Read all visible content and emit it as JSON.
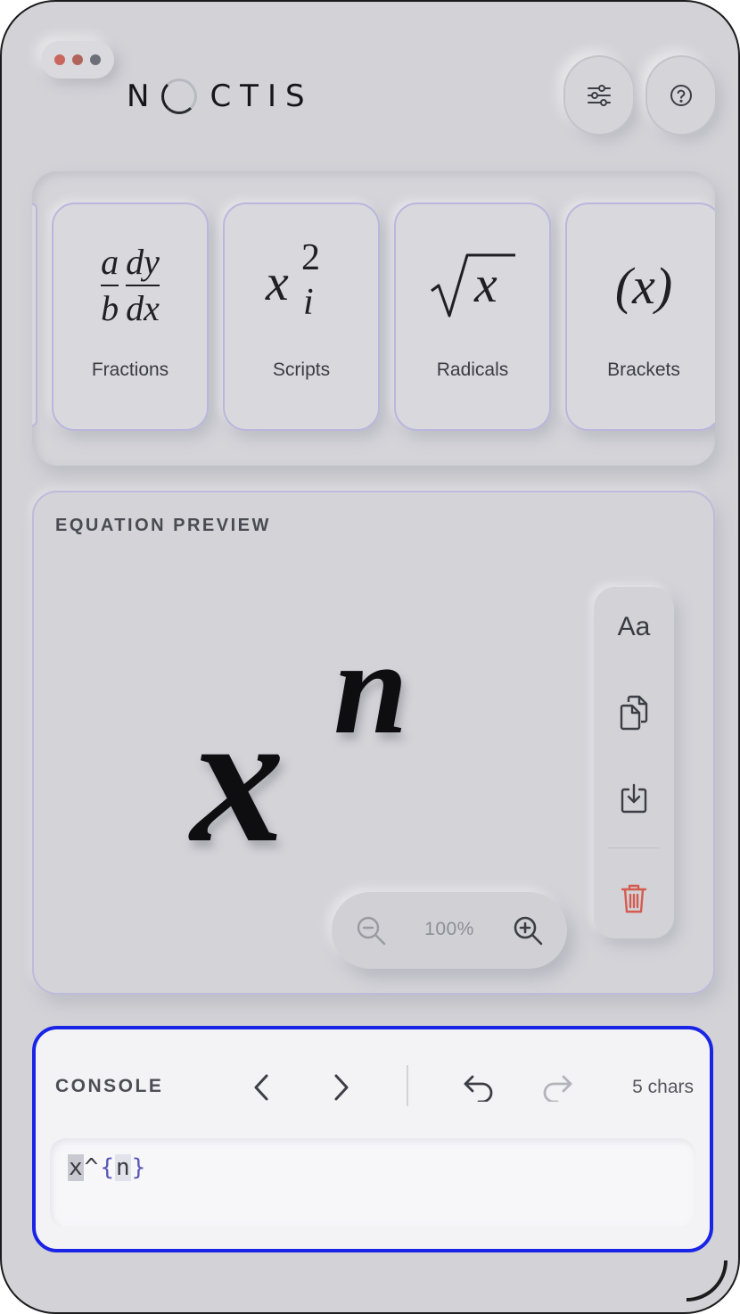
{
  "app": {
    "logo_left": "N",
    "logo_right": "CTIS",
    "window_dots": [
      {
        "color": "#c9675c"
      },
      {
        "color": "#b0655c"
      },
      {
        "color": "#6c6f78"
      }
    ]
  },
  "header": {
    "settings_icon": "sliders-icon",
    "help_icon": "help-circle-icon"
  },
  "templates": [
    {
      "label": "Fractions",
      "icon": "fraction-icon"
    },
    {
      "label": "Scripts",
      "icon": "scripts-icon",
      "base": "x",
      "sup": "2",
      "sub": "i"
    },
    {
      "label": "Radicals",
      "icon": "radical-icon",
      "radicand": "x"
    },
    {
      "label": "Brackets",
      "icon": "brackets-icon",
      "text": "(x)"
    }
  ],
  "fractions_sample": {
    "a": "a",
    "b": "b",
    "dy": "dy",
    "dx": "dx"
  },
  "preview": {
    "title": "EQUATION PREVIEW",
    "equation_base": "x",
    "equation_sup": "n",
    "font_button": "Aa",
    "zoom": "100%"
  },
  "console": {
    "title": "CONSOLE",
    "char_count": "5 chars",
    "code_tokens": [
      "x",
      "^",
      "{",
      "n",
      "}"
    ]
  },
  "colors": {
    "accent_border": "#1a24e6",
    "danger": "#d65b4f"
  }
}
